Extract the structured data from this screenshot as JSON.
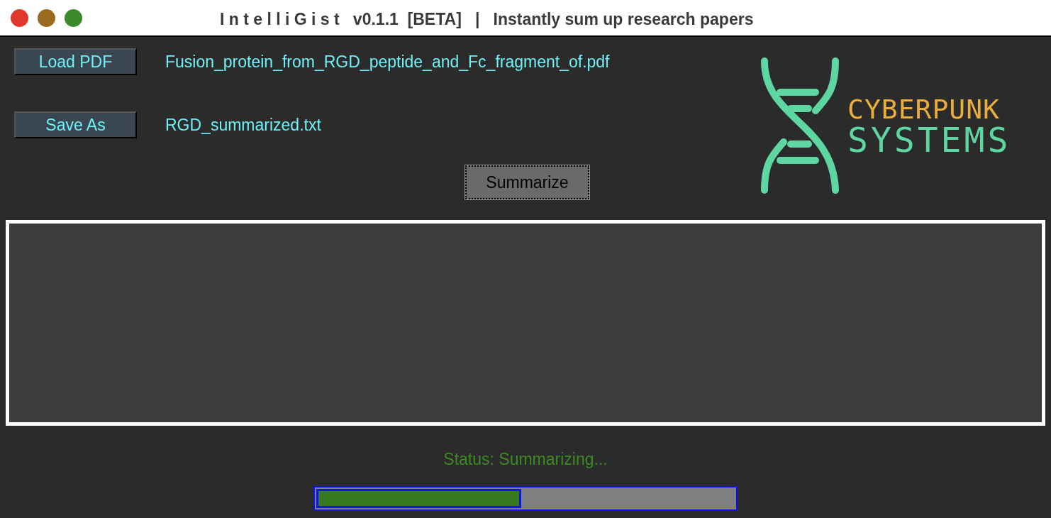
{
  "window": {
    "title": "I n t e l l i G i s t   v0.1.1  [BETA]   |   Instantly sum up research papers"
  },
  "files": [
    {
      "button": "Load PDF",
      "filename": "Fusion_protein_from_RGD_peptide_and_Fc_fragment_of.pdf"
    },
    {
      "button": "Save As",
      "filename": "RGD_summarized.txt"
    }
  ],
  "summarize_button": "Summarize",
  "logo": {
    "line_1": "CYBERPUNK",
    "line_2": "SYSTEMS"
  },
  "status": "Status: Summarizing...",
  "progress": {
    "level": 0.49
  }
}
